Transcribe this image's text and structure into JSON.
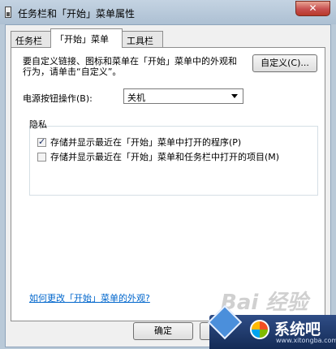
{
  "window": {
    "title": "任务栏和「开始」菜单属性",
    "close_glyph": "✕"
  },
  "tabs": [
    {
      "label": "任务栏",
      "active": false
    },
    {
      "label": "「开始」菜单",
      "active": true
    },
    {
      "label": "工具栏",
      "active": false
    }
  ],
  "start_menu": {
    "description": "要自定义链接、图标和菜单在「开始」菜单中的外观和行为，请单击“自定义”。",
    "customize_label": "自定义(C)...",
    "power_label": "电源按钮操作(B):",
    "power_value": "关机",
    "privacy_title": "隐私",
    "options": [
      {
        "label": "存储并显示最近在「开始」菜单中打开的程序(P)",
        "checked": true
      },
      {
        "label": "存储并显示最近在「开始」菜单和任务栏中打开的项目(M)",
        "checked": false
      }
    ],
    "help_link": "如何更改「开始」菜单的外观?"
  },
  "footer": {
    "ok_label": "确定",
    "cancel_label": ""
  },
  "watermark": {
    "baidu_text": "Bai 经验",
    "brand_name": "系统吧",
    "brand_url": "www.xitongba.com"
  }
}
